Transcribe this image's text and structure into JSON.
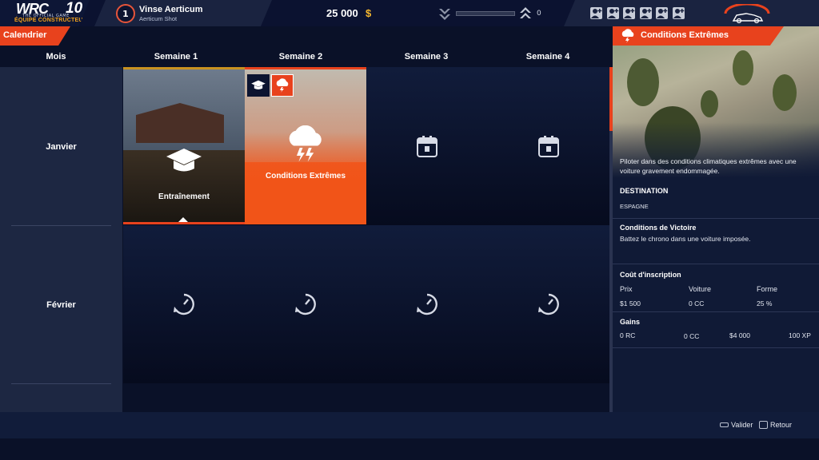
{
  "header": {
    "logo_text": "WRC",
    "logo_number": "10",
    "logo_subtitle": "THE OFFICIAL GAME",
    "logo_team": "ÉQUIPE CONSTRUCTEUR",
    "player_rank": "1",
    "player_name": "Vinse Aerticum",
    "player_team": "Aerticum Shot",
    "money": "25 000",
    "currency": "$",
    "level_value": "0",
    "level_progress": 0,
    "crew_slots": 6
  },
  "calendar": {
    "tab_label": "Calendrier",
    "col_month": "Mois",
    "weeks": [
      "Semaine 1",
      "Semaine 2",
      "Semaine 3",
      "Semaine 4"
    ],
    "months": [
      "Janvier",
      "Février"
    ],
    "events": {
      "training_label": "Entraînement",
      "extreme_label": "Conditions Extrêmes"
    }
  },
  "panel": {
    "title": "Conditions Extrêmes",
    "description": "Piloter dans des conditions climatiques extrêmes avec une voiture gravement endommagée.",
    "destination_title": "DESTINATION",
    "destination_value": "ESPAGNE",
    "victory_title": "Conditions de Victoire",
    "victory_text": "Battez le chrono dans une voiture imposée.",
    "cost_title": "Coût d'inscription",
    "cost_headers": [
      "Prix",
      "Voiture",
      "Forme"
    ],
    "cost_values": [
      "$1 500",
      "0 CC",
      "25 %"
    ],
    "gains_title": "Gains",
    "gains_values": [
      "0 RC",
      "0 CC",
      "$4 000",
      "100 XP"
    ]
  },
  "footer": {
    "validate_label": "Valider",
    "back_label": "Retour"
  },
  "colors": {
    "accent": "#e8421d",
    "gold": "#f5b82e",
    "bg": "#0a1128"
  }
}
